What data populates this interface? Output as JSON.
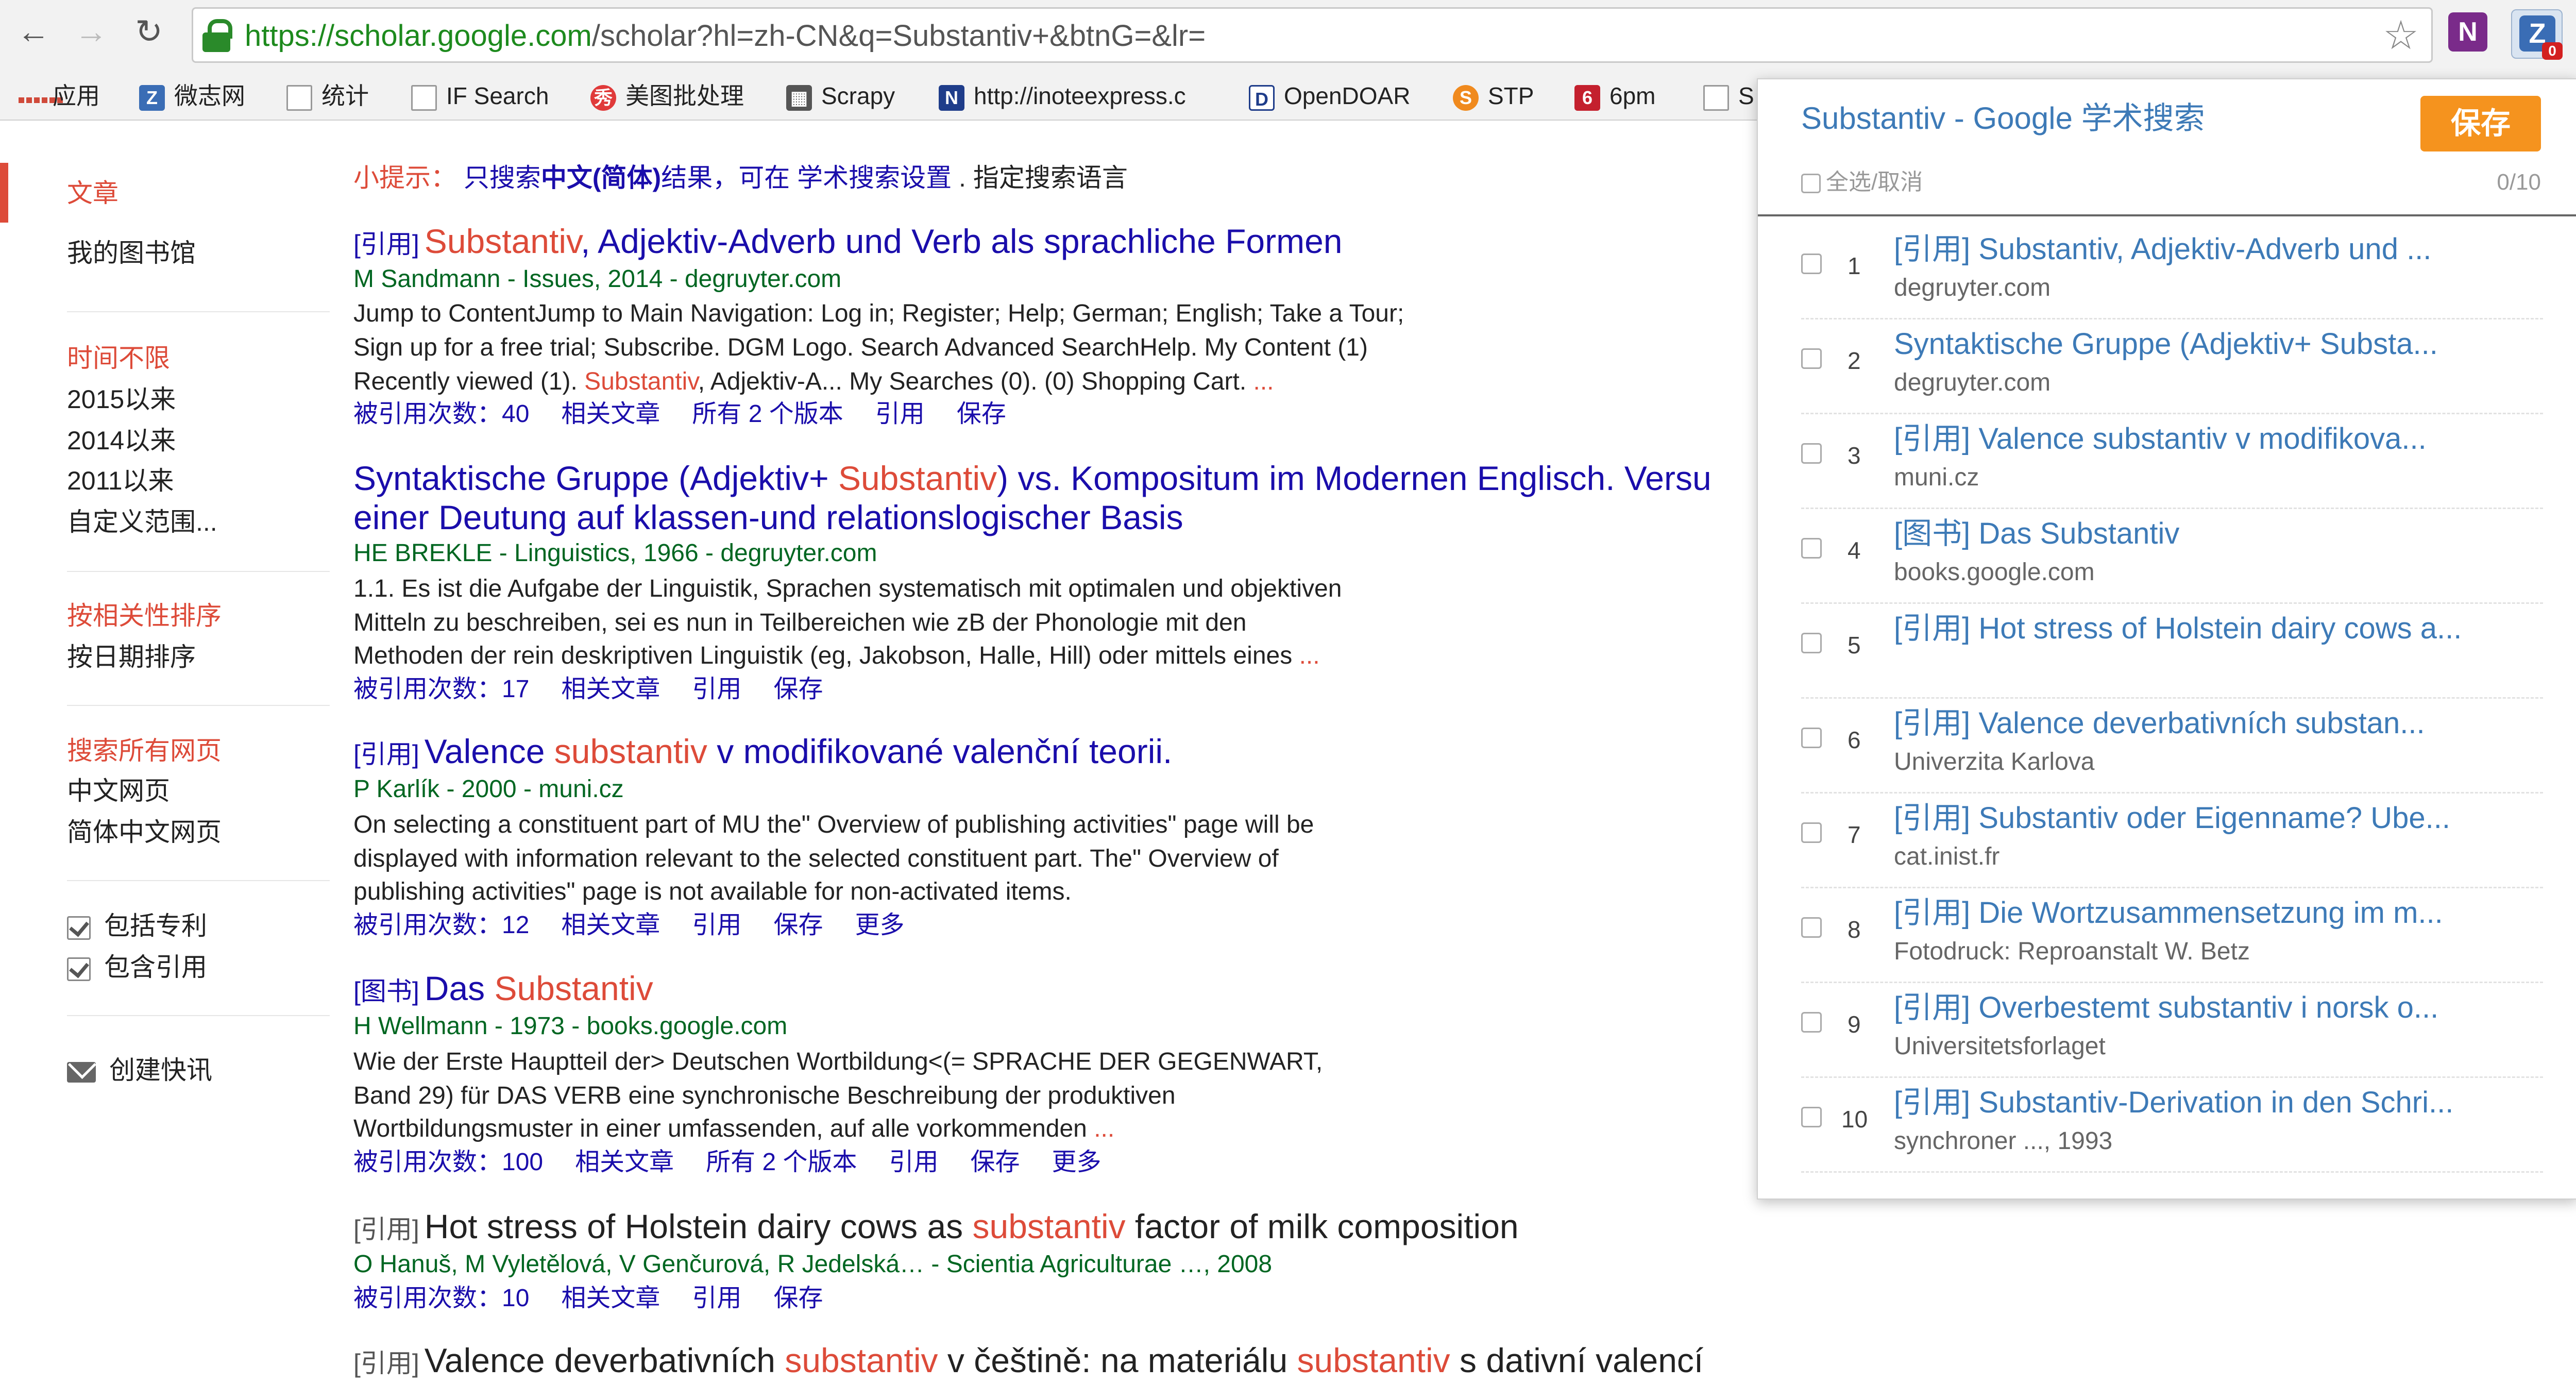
{
  "browser": {
    "url_scheme": "https://",
    "url_domain": "scholar.google.com",
    "url_path": "/scholar?hl=zh-CN&q=Substantiv+&btnG=&lr=",
    "extension_badge": "0",
    "onenote_label": "N",
    "z_label": "Z"
  },
  "bookmarks": [
    {
      "label": "应用",
      "icon": "apps-grid-icon"
    },
    {
      "label": "微志网",
      "icon": "z-logo-icon"
    },
    {
      "label": "统计",
      "icon": "page-icon"
    },
    {
      "label": "IF Search",
      "icon": "page-icon"
    },
    {
      "label": "美图批处理",
      "icon": "meitu-icon"
    },
    {
      "label": "Scrapy",
      "icon": "scrapy-icon"
    },
    {
      "label": "http://inoteexpress.c",
      "icon": "noteexpress-icon"
    },
    {
      "label": "OpenDOAR",
      "icon": "opendoar-icon"
    },
    {
      "label": "STP",
      "icon": "stp-icon"
    },
    {
      "label": "6pm",
      "icon": "6pm-icon"
    },
    {
      "label": "S",
      "icon": "page-icon"
    }
  ],
  "sidebar": {
    "articles": "文章",
    "my_library": "我的图书馆",
    "time_any": "时间不限",
    "since_2015": "2015以来",
    "since_2014": "2014以来",
    "since_2011": "2011以来",
    "custom_range": "自定义范围...",
    "sort_relevance": "按相关性排序",
    "sort_date": "按日期排序",
    "search_all": "搜索所有网页",
    "chinese_pages": "中文网页",
    "simplified_pages": "简体中文网页",
    "include_patents": "包括专利",
    "include_citations": "包含引用",
    "create_alert": "创建快讯"
  },
  "tip": {
    "prefix": "小提示：",
    "part1": "只搜索",
    "bold": "中文(简体)",
    "part2": "结果，可在",
    "link": "学术搜索设置",
    "part3": ". 指定搜索语言"
  },
  "results": [
    {
      "tag": "[引用]",
      "title_hl": "Substantiv",
      "title_rest": ", Adjektiv-Adverb und Verb als sprachliche Formen",
      "meta": "M Sandmann - Issues, 2014 - degruyter.com",
      "snippet1": "Jump to ContentJump to Main Navigation: Log in; Register; Help; German; English; Take a Tour;",
      "snippet2": "Sign up for a free trial; Subscribe. DGM Logo. Search Advanced SearchHelp. My Content (1)",
      "snippet3_pre": "Recently viewed (1). ",
      "snippet3_hl": "Substantiv",
      "snippet3_post": ", Adjektiv-A... My Searches (0). (0) Shopping Cart. ",
      "ellipsis": "...",
      "cited": "被引用次数：40",
      "related": "相关文章",
      "versions": "所有 2 个版本",
      "cite": "引用",
      "save": "保存"
    },
    {
      "title_pre": "Syntaktische Gruppe (Adjektiv+ ",
      "title_hl": "Substantiv",
      "title_post": ") vs. Kompositum im Modernen Englisch. Versu",
      "title_line2": "einer Deutung auf klassen-und relationslogischer Basis",
      "meta": "HE BREKLE - Linguistics, 1966 - degruyter.com",
      "snippet1": "1.1. Es ist die Aufgabe der Linguistik, Sprachen systematisch mit optimalen und objektiven",
      "snippet2": "Mitteln zu beschreiben, sei es nun in Teilbereichen wie zB der Phonologie mit den",
      "snippet3": "Methoden der rein deskriptiven Linguistik (eg, Jakobson, Halle, Hill) oder mittels eines ",
      "ellipsis": "...",
      "cited": "被引用次数：17",
      "related": "相关文章",
      "cite": "引用",
      "save": "保存"
    },
    {
      "tag": "[引用]",
      "title_pre": "Valence ",
      "title_hl": "substantiv",
      "title_post": " v modifikované valenční teorii.",
      "meta": "P Karlík - 2000 - muni.cz",
      "snippet1": "On selecting a constituent part of MU the\" Overview of publishing activities\" page will be",
      "snippet2": "displayed with information relevant to the selected constituent part. The\" Overview of",
      "snippet3": "publishing activities\" page is not available for non-activated items.",
      "cited": "被引用次数：12",
      "related": "相关文章",
      "cite": "引用",
      "save": "保存",
      "more": "更多"
    },
    {
      "tag": "[图书]",
      "title_pre": "Das ",
      "title_hl": "Substantiv",
      "meta": "H Wellmann - 1973 - books.google.com",
      "snippet1": "Wie der Erste Hauptteil der> Deutschen Wortbildung<(= SPRACHE DER GEGENWART,",
      "snippet2": "Band 29) für DAS VERB eine synchronische Beschreibung der produktiven",
      "snippet3": "Wortbildungsmuster in einer umfassenden, auf alle vorkommenden ",
      "ellipsis": "...",
      "cited": "被引用次数：100",
      "related": "相关文章",
      "versions": "所有 2 个版本",
      "cite": "引用",
      "save": "保存",
      "more": "更多"
    },
    {
      "tag": "[引用]",
      "title_pre": "Hot stress of Holstein dairy cows as ",
      "title_hl": "substantiv",
      "title_post": " factor of milk composition",
      "meta": "O Hanuš, M Vyletělová, V Genčurová, R Jedelská… - Scientia Agriculturae …, 2008",
      "cited": "被引用次数：10",
      "related": "相关文章",
      "cite": "引用",
      "save": "保存"
    },
    {
      "tag": "[引用]",
      "title_pre": "Valence deverbativních ",
      "title_hl": "substantiv",
      "title_mid": " v češtině: na materiálu ",
      "title_hl2": "substantiv",
      "title_post": " s dativní valencí"
    }
  ],
  "popup": {
    "title": "Substantiv - Google 学术搜索",
    "save": "保存",
    "select_all": "全选/取消",
    "count": "0/10",
    "items": [
      {
        "num": "1",
        "title": "[引用] Substantiv, Adjektiv-Adverb und ...",
        "source": "degruyter.com"
      },
      {
        "num": "2",
        "title": "Syntaktische Gruppe (Adjektiv+ Substa...",
        "source": "degruyter.com"
      },
      {
        "num": "3",
        "title": "[引用] Valence substantiv v modifikova...",
        "source": "muni.cz"
      },
      {
        "num": "4",
        "title": "[图书] Das Substantiv",
        "source": "books.google.com"
      },
      {
        "num": "5",
        "title": "[引用] Hot stress of Holstein dairy cows a...",
        "source": ""
      },
      {
        "num": "6",
        "title": "[引用] Valence deverbativních substan...",
        "source": "Univerzita Karlova"
      },
      {
        "num": "7",
        "title": "[引用] Substantiv oder Eigenname? Ube...",
        "source": "cat.inist.fr"
      },
      {
        "num": "8",
        "title": "[引用] Die Wortzusammensetzung im m...",
        "source": "Fotodruck: Reproanstalt W. Betz"
      },
      {
        "num": "9",
        "title": "[引用] Overbestemt substantiv i norsk o...",
        "source": "Universitetsforlaget"
      },
      {
        "num": "10",
        "title": "[引用] Substantiv-Derivation in den Schri...",
        "source": "synchroner ..., 1993"
      }
    ]
  }
}
